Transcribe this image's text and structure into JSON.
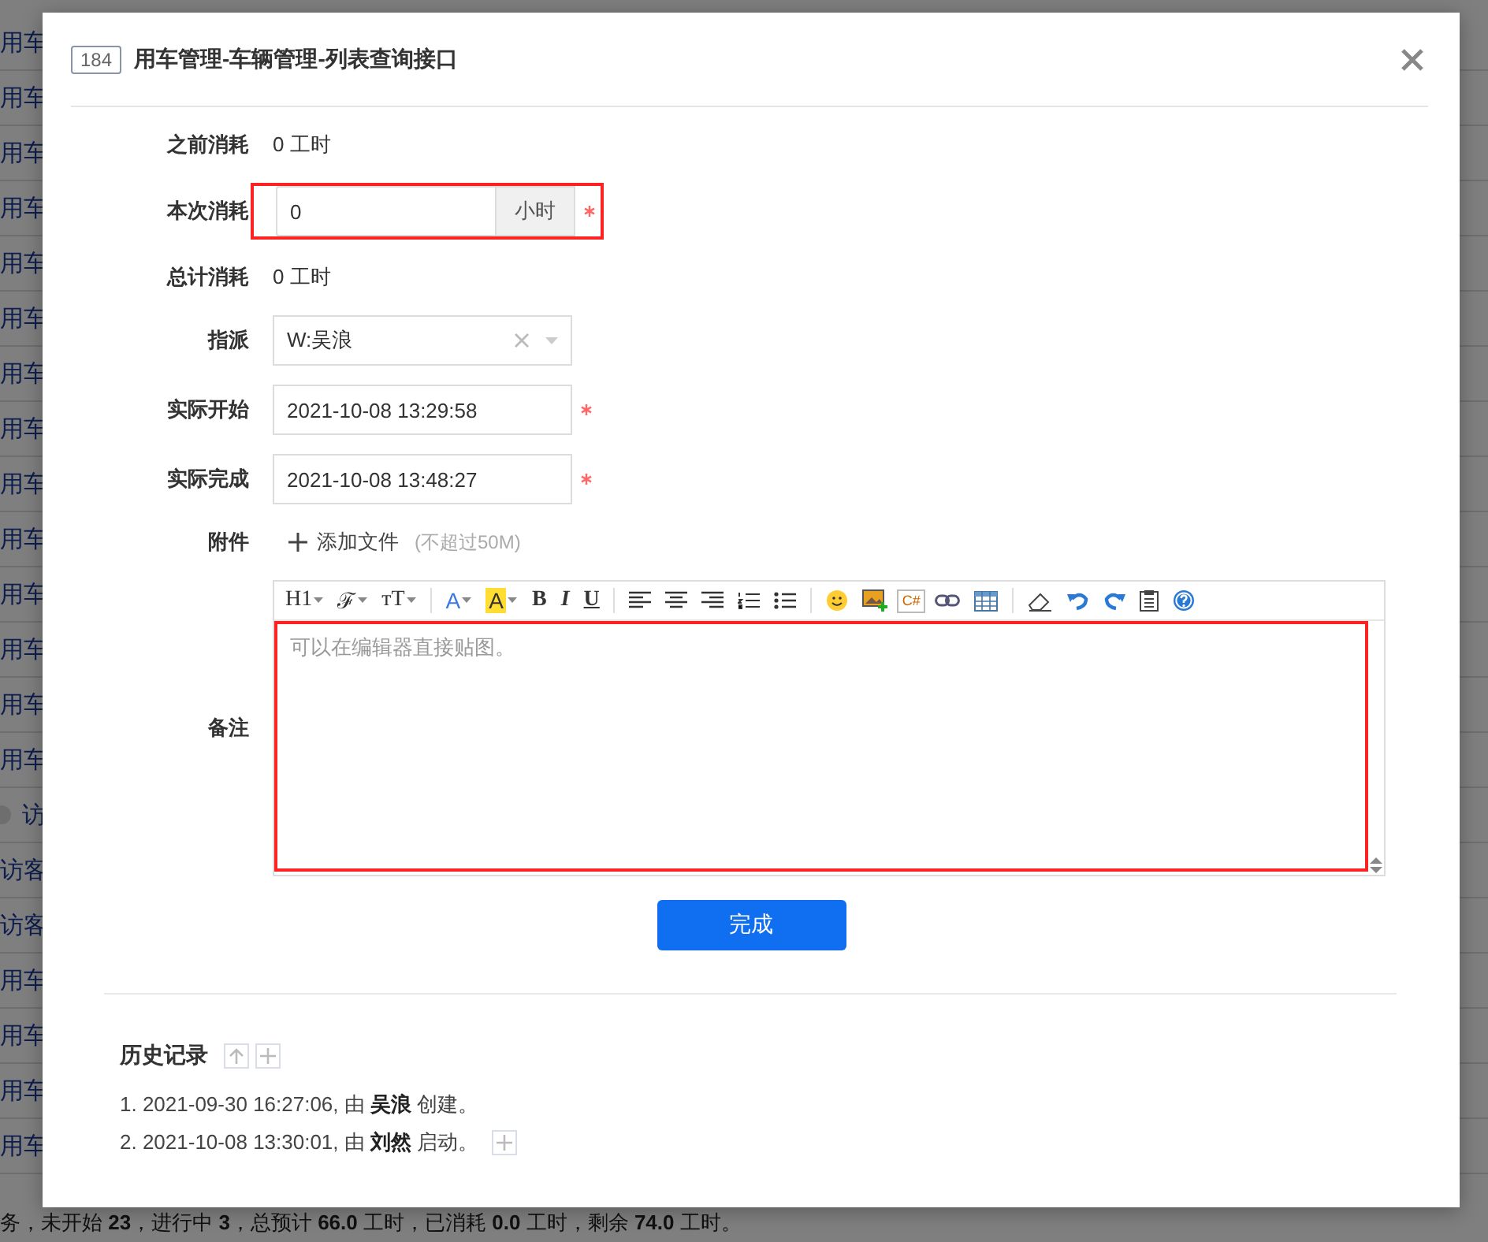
{
  "background": {
    "rows": [
      {
        "kind": "task",
        "text": "用车"
      },
      {
        "kind": "task",
        "text": "用车"
      },
      {
        "kind": "task",
        "text": "用车"
      },
      {
        "kind": "task",
        "text": "用车"
      },
      {
        "kind": "task",
        "text": "用车"
      },
      {
        "kind": "task",
        "text": "用车"
      },
      {
        "kind": "task",
        "text": "用车"
      },
      {
        "kind": "task",
        "text": "用车"
      },
      {
        "kind": "task",
        "text": "用车"
      },
      {
        "kind": "task",
        "text": "用车"
      },
      {
        "kind": "task",
        "text": "用车"
      },
      {
        "kind": "task",
        "text": "用车"
      },
      {
        "kind": "task",
        "text": "用车"
      },
      {
        "kind": "task",
        "text": "用车"
      },
      {
        "kind": "parent",
        "text": "访"
      },
      {
        "kind": "task",
        "text": "访客"
      },
      {
        "kind": "task",
        "text": "访客"
      },
      {
        "kind": "task",
        "text": "用车"
      },
      {
        "kind": "task",
        "text": "用车"
      },
      {
        "kind": "task",
        "text": "用车"
      },
      {
        "kind": "task",
        "text": "用车"
      }
    ],
    "summary": "务，未开始 **23**，进行中 **3**，总预计 **66.0** 工时，已消耗 **0.0** 工时，剩余 **74.0** 工时。"
  },
  "dialog": {
    "id": "184",
    "title": "用车管理-车辆管理-列表查询接口",
    "fields": [
      {
        "kind": "text",
        "label": "之前消耗",
        "value": "0 工时"
      },
      {
        "kind": "hours",
        "label": "本次消耗",
        "value": "0",
        "unit": "小时",
        "required": true,
        "highlighted": true
      },
      {
        "kind": "text",
        "label": "总计消耗",
        "value": "0 工时"
      },
      {
        "kind": "select",
        "label": "指派",
        "value": "W:吴浪"
      },
      {
        "kind": "datetime",
        "label": "实际开始",
        "value": "2021-10-08 13:29:58",
        "required": true
      },
      {
        "kind": "datetime",
        "label": "实际完成",
        "value": "2021-10-08 13:48:27",
        "required": true
      },
      {
        "kind": "attachment",
        "label": "附件",
        "action": "添加文件",
        "hint": "(不超过50M)"
      },
      {
        "kind": "editor",
        "label": "备注",
        "placeholder": "可以在编辑器直接贴图。",
        "highlighted": true,
        "toolbar": [
          {
            "kind": "heading",
            "label": "H1"
          },
          {
            "kind": "font",
            "label": "ℱ"
          },
          {
            "kind": "size",
            "label": "тT"
          },
          {
            "kind": "sep"
          },
          {
            "kind": "font-color",
            "label": "A"
          },
          {
            "kind": "bg-color",
            "label": "A"
          },
          {
            "kind": "bold",
            "label": "B"
          },
          {
            "kind": "italic",
            "label": "I"
          },
          {
            "kind": "underline",
            "label": "U"
          },
          {
            "kind": "sep"
          },
          {
            "kind": "align-left"
          },
          {
            "kind": "align-center"
          },
          {
            "kind": "align-right"
          },
          {
            "kind": "ordered-list"
          },
          {
            "kind": "bullet-list"
          },
          {
            "kind": "sep"
          },
          {
            "kind": "emoji"
          },
          {
            "kind": "image"
          },
          {
            "kind": "code",
            "label": "C#"
          },
          {
            "kind": "link"
          },
          {
            "kind": "table"
          },
          {
            "kind": "sep"
          },
          {
            "kind": "eraser"
          },
          {
            "kind": "undo"
          },
          {
            "kind": "redo"
          },
          {
            "kind": "paste"
          },
          {
            "kind": "help"
          }
        ]
      }
    ],
    "submit": "完成",
    "history": {
      "title": "历史记录",
      "entries": [
        {
          "text": "1. 2021-09-30 16:27:06, 由 **吴浪** 创建。",
          "expandable": false
        },
        {
          "text": "2. 2021-10-08 13:30:01, 由 **刘然** 启动。",
          "expandable": true
        }
      ]
    }
  }
}
